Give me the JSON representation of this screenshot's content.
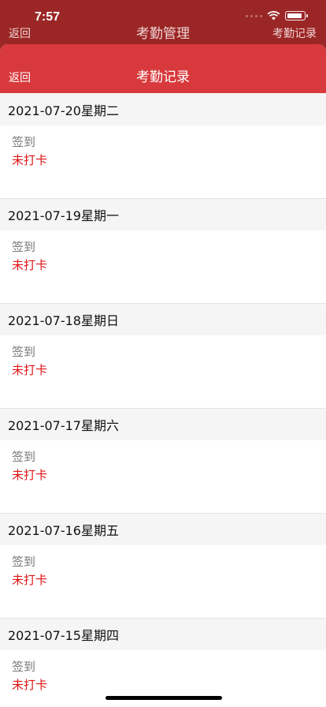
{
  "status_bar": {
    "time": "7:57"
  },
  "back_page": {
    "nav_left": "返回",
    "nav_title": "考勤管理",
    "nav_right": "考勤记录"
  },
  "sheet": {
    "back_label": "返回",
    "title": "考勤记录"
  },
  "records": [
    {
      "date": "2021-07-20星期二",
      "label": "签到",
      "status": "未打卡"
    },
    {
      "date": "2021-07-19星期一",
      "label": "签到",
      "status": "未打卡"
    },
    {
      "date": "2021-07-18星期日",
      "label": "签到",
      "status": "未打卡"
    },
    {
      "date": "2021-07-17星期六",
      "label": "签到",
      "status": "未打卡"
    },
    {
      "date": "2021-07-16星期五",
      "label": "签到",
      "status": "未打卡"
    },
    {
      "date": "2021-07-15星期四",
      "label": "签到",
      "status": "未打卡"
    }
  ],
  "colors": {
    "header_red": "#d8393c",
    "back_header_red": "#9b2626",
    "status_red": "#e01515"
  }
}
